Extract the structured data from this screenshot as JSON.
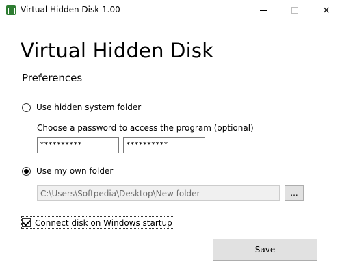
{
  "window": {
    "title": "Virtual Hidden Disk 1.00",
    "icon": "app-disk-icon",
    "accent": "#2e7d32"
  },
  "controls": {
    "minimize": "minimize-icon",
    "maximize": "maximize-icon",
    "close": "×"
  },
  "main": {
    "heading": "Virtual Hidden Disk",
    "subheading": "Preferences"
  },
  "options": {
    "hidden_folder_label": "Use hidden system folder",
    "hidden_folder_selected": false,
    "password_label": "Choose a password to access the program (optional)",
    "password1": "**********",
    "password2": "**********",
    "own_folder_label": "Use my own folder",
    "own_folder_selected": true,
    "folder_path": "C:\\Users\\Softpedia\\Desktop\\New folder",
    "browse_label": "...",
    "startup_label": "Connect disk on Windows startup",
    "startup_checked": true
  },
  "actions": {
    "save_label": "Save"
  }
}
